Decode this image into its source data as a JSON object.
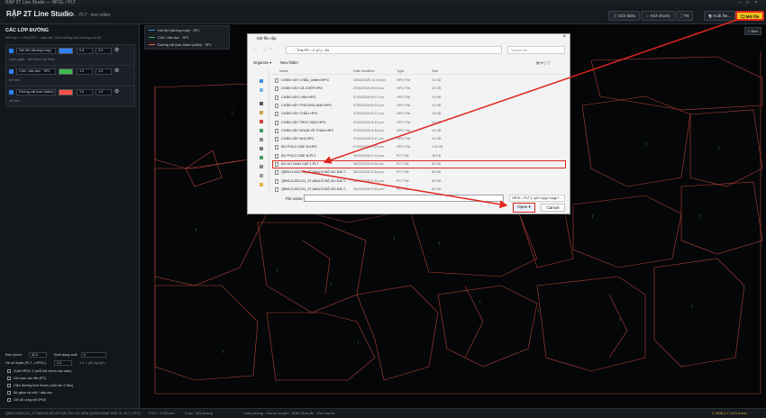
{
  "window": {
    "title": "RẬP 2T Line Studio — HPGL / PLT"
  },
  "app": {
    "brand": "RẬP 2T Line Studio",
    "subtitle": "HPGL · PLT · line editor"
  },
  "toolbar": {
    "buttons": [
      {
        "label": "Giới thiệu",
        "icon": "info-icon"
      },
      {
        "label": "Kích thước",
        "icon": "ruler-icon"
      },
      {
        "label": "Fit",
        "icon": "fit-icon"
      },
      {
        "label": "Xuất file...",
        "icon": "save-icon"
      },
      {
        "label": "Mở file",
        "icon": "folder-icon"
      }
    ],
    "right_button": "Nền"
  },
  "left_panel": {
    "section_title": "CÁC LỚP ĐƯỜNG",
    "section_hint": "Mỗi lớp = 1 Bút (SP) + màu nét. Giữa không ảnh hưởng tọa độ.",
    "layers": [
      {
        "name": "Nét đứt (đường may)",
        "color": "#2f81f7",
        "v1": "0.8",
        "v2": "2.0",
        "hint": "Cách ngắn · nét 2mm / hở 3mm"
      },
      {
        "name": "Chữ / dấu dọc · SP1",
        "color": "#3fb950",
        "v1": "1.0",
        "v2": "1.0",
        "hint": "nét liền"
      },
      {
        "name": "Đường cắt (bán thành)",
        "color": "#f85149",
        "v1": "1.0",
        "v2": "1.0",
        "hint": "nét liền"
      }
    ],
    "units_label": "Đơn vị/mm",
    "units_value": "40.0",
    "format_label": "Định dạng xuất",
    "scale_label": "Hệ số Scale (PLT→HPGL)",
    "scale_value": "1.0",
    "scale_hint": "0.9 = giữ nguyên",
    "options": [
      "Xuất HPGL-2 (mỗi bút chính xác màu)",
      "Ghi màu vào file (PC)",
      "Hiện đường kích thước (mỗi lớn 2 đầu)",
      "Bỏ giảm cả chữ / dấu dọc",
      "Ghi độ rộng nét (PW)"
    ]
  },
  "legend": {
    "items": [
      {
        "label": "Nét đứt (đường may) · SP1",
        "color": "#2f81f7"
      },
      {
        "label": "Chữ / dấu dọc · SP1",
        "color": "#3fb950"
      },
      {
        "label": "Đường cắt (bán thành phẩm) · SP1",
        "color": "#f85149"
      }
    ]
  },
  "dialog": {
    "title": "Mở file rập",
    "address": "This PC  ›  C (C:)  ›  IN",
    "search_placeholder": "Search IN",
    "organize": "Organize ▾",
    "new_folder": "New folder",
    "columns": [
      "Name",
      "Date modified",
      "Type",
      "Size"
    ],
    "files": [
      {
        "name": "CHÂN VÁY CHẤU_edited.HPG",
        "date": "14/06/2026 12:30 pm",
        "type": "HPG File",
        "size": "10 KB"
      },
      {
        "name": "CHÂN VÁY CÁ CHÉP.HPG",
        "date": "07/06/2026 8:02 pm",
        "type": "HPG File",
        "size": "10 KB"
      },
      {
        "name": "CHÂN VÁY LINH.HPG",
        "date": "07/06/2026 8:07 pm",
        "type": "HPG File",
        "size": "10 KB"
      },
      {
        "name": "CHÂN VÁY PHƯƠNG ANH.HPG",
        "date": "07/06/2026 8:03 pm",
        "type": "HPG File",
        "size": "10 KB"
      },
      {
        "name": "CHÂN VÁY CHẤU.HPG",
        "date": "07/06/2026 8:07 pm",
        "type": "HPG File",
        "size": "10 KB"
      },
      {
        "name": "CHÂN VÁY TRÚC ĐÀO.HPG",
        "date": "07/06/2026 8:10 pm",
        "type": "HPG File",
        "size": "10 KB"
      },
      {
        "name": "CHÂN VÁY NGẠN VỀ TOAN.HPG",
        "date": "07/06/2026 8:48 pm",
        "type": "HPG File",
        "size": "10 KB"
      },
      {
        "name": "CHÂN VÁY NHI.HPG",
        "date": "07/06/2026 8:47 pm",
        "type": "HPG File",
        "size": "10 KB"
      },
      {
        "name": "ÁO POLO SIZE M.HPG",
        "date": "07/06/2026 2:19 pm",
        "type": "HPG File",
        "size": "176 KB"
      },
      {
        "name": "ÁO POLO SIZE M.PLT",
        "date": "10/05/2026 2:14 pm",
        "type": "PLT File",
        "size": "16 KB"
      },
      {
        "name": "ÁO SƠ NAM CẠP 1.PLT",
        "date": "08/05/2026 8:28 am",
        "type": "PLT File",
        "size": "83 KB"
      },
      {
        "name": "QBHLD-BGCX1_2T-MAU13 BỘ ÁO DÀI T...",
        "date": "26/04/2026 5:34 pm",
        "type": "PLT File",
        "size": "84 KB"
      },
      {
        "name": "QBHLD-BGCX1_2T-MAU13 BỘ ÁO DÀI T...",
        "date": "26/04/2026 5:34 pm",
        "type": "PLT File",
        "size": "84 KB"
      },
      {
        "name": "QBHLD-BGCX1_2T-MAU13 BỘ ÁO DÀI T...",
        "date": "26/04/2026 5:34 pm",
        "type": "PLT File",
        "size": "84 KB"
      }
    ],
    "filename_label": "File name:",
    "filename_value": "",
    "filetype": "HPGL / PLT (*.plt;*.hpg;*.hpgl;*...",
    "open_label": "Open",
    "cancel_label": "Cancel"
  },
  "status": {
    "file": "QBHLD-BGCX1_2T-MAU13 BỘ ÁO DÀI TAY CÓ VIỀN QUẦN ROMI SIZE XL.PLT (.PLT)",
    "size": "2707 × 1700 mm",
    "counts": "3 lớp · 345 đường",
    "help": "Cuộn=phóng · Kéo=di chuyển · Shift+Click=ẩn · Esc=xóa ẩn",
    "coords": "X 2038.3   Y 1472.8 mm"
  }
}
